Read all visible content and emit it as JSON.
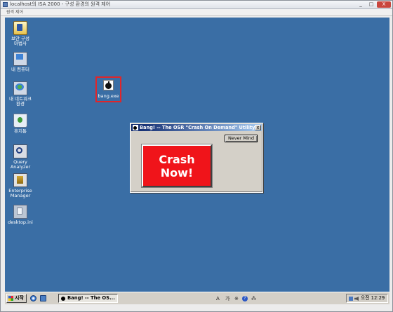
{
  "rdp": {
    "title": "localhost의 ISA 2000 - 구성 환경의 원격 제어",
    "menu": "원격 제어",
    "buttons": [
      "_",
      "□",
      "X"
    ]
  },
  "desktop": {
    "background_color": "#3a6ea5",
    "icons": [
      {
        "label_line1": "보안 구성",
        "label_line2": "마법사",
        "icon": "security-wizard-icon"
      },
      {
        "label_line1": "내 컴퓨터",
        "label_line2": "",
        "icon": "my-computer-icon"
      },
      {
        "label_line1": "내 네트워크",
        "label_line2": "환경",
        "icon": "network-places-icon"
      },
      {
        "label_line1": "휴지통",
        "label_line2": "",
        "icon": "recycle-bin-icon"
      },
      {
        "label_line1": "Query",
        "label_line2": "Analyzer",
        "icon": "query-analyzer-icon"
      },
      {
        "label_line1": "Enterprise",
        "label_line2": "Manager",
        "icon": "enterprise-manager-icon"
      },
      {
        "label_line1": "desktop.ini",
        "label_line2": "",
        "icon": "ini-file-icon"
      }
    ],
    "bang_icon": {
      "label": "bang.exe",
      "highlight_color": "#e0262a"
    }
  },
  "dialog": {
    "title": "Bang! -- The OSR \"Crash On Demand\" Utility",
    "close": "x",
    "never_mind": "Never Mind",
    "crash_line1": "Crash",
    "crash_line2": "Now!",
    "crash_color": "#f0141a"
  },
  "taskbar": {
    "start": "시작",
    "task_label": "Bang! -- The OS...",
    "ime_a": "A",
    "ime_han": "가",
    "ime_settings": "※",
    "ime_help": "?",
    "ime_last": "⁂",
    "clock": "오전 12:29"
  }
}
